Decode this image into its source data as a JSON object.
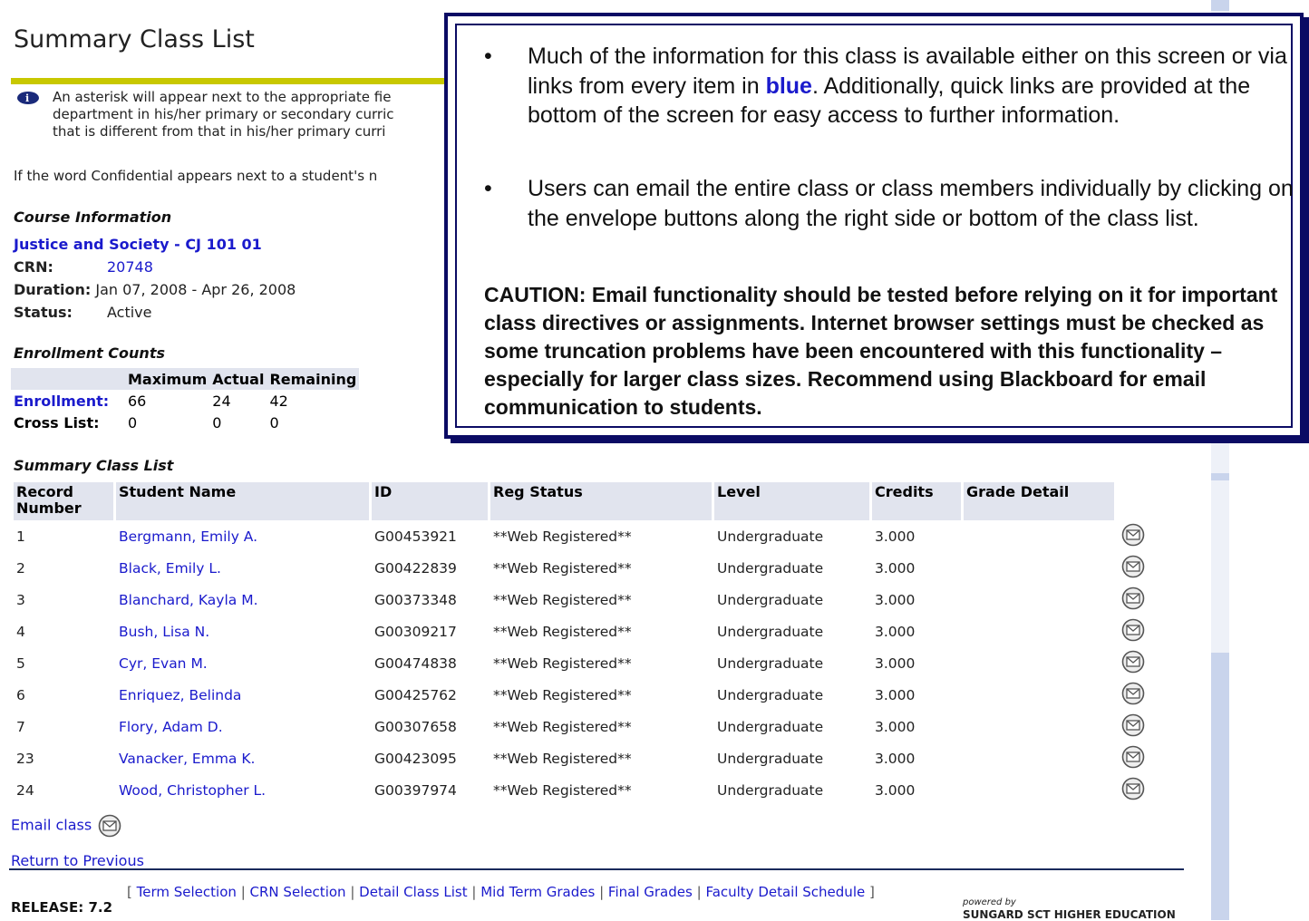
{
  "page_title": "Summary Class List",
  "info_note": {
    "line1": "An asterisk will appear next to the appropriate fie",
    "line2": "department in his/her primary or secondary curric",
    "line3": "that is different from that in his/her primary curri"
  },
  "confidential_note": "If the word Confidential appears next to a student's n",
  "course_info": {
    "heading": "Course Information",
    "title": "Justice and Society - CJ 101 01",
    "crn_label": "CRN:",
    "crn": "20748",
    "duration_label": "Duration:",
    "duration": "Jan 07, 2008 - Apr 26, 2008",
    "status_label": "Status:",
    "status": "Active"
  },
  "enrollment": {
    "heading": "Enrollment Counts",
    "headers": [
      "",
      "Maximum",
      "Actual",
      "Remaining"
    ],
    "rows": [
      {
        "label": "Enrollment:",
        "maximum": "66",
        "actual": "24",
        "remaining": "42"
      },
      {
        "label": "Cross List:",
        "maximum": "0",
        "actual": "0",
        "remaining": "0"
      }
    ]
  },
  "roster": {
    "heading": "Summary Class List",
    "headers": {
      "record": "Record Number",
      "name": "Student Name",
      "id": "ID",
      "reg_status": "Reg Status",
      "level": "Level",
      "credits": "Credits",
      "grade_detail": "Grade Detail"
    },
    "rows": [
      {
        "num": "1",
        "name": "Bergmann, Emily A.",
        "id": "G00453921",
        "reg": "**Web Registered**",
        "level": "Undergraduate",
        "credits": "3.000"
      },
      {
        "num": "2",
        "name": "Black, Emily L.",
        "id": "G00422839",
        "reg": "**Web Registered**",
        "level": "Undergraduate",
        "credits": "3.000"
      },
      {
        "num": "3",
        "name": "Blanchard, Kayla M.",
        "id": "G00373348",
        "reg": "**Web Registered**",
        "level": "Undergraduate",
        "credits": "3.000"
      },
      {
        "num": "4",
        "name": "Bush, Lisa N.",
        "id": "G00309217",
        "reg": "**Web Registered**",
        "level": "Undergraduate",
        "credits": "3.000"
      },
      {
        "num": "5",
        "name": "Cyr, Evan M.",
        "id": "G00474838",
        "reg": "**Web Registered**",
        "level": "Undergraduate",
        "credits": "3.000"
      },
      {
        "num": "6",
        "name": "Enriquez, Belinda",
        "id": "G00425762",
        "reg": "**Web Registered**",
        "level": "Undergraduate",
        "credits": "3.000"
      },
      {
        "num": "7",
        "name": "Flory, Adam D.",
        "id": "G00307658",
        "reg": "**Web Registered**",
        "level": "Undergraduate",
        "credits": "3.000"
      },
      {
        "num": "23",
        "name": "Vanacker, Emma K.",
        "id": "G00423095",
        "reg": "**Web Registered**",
        "level": "Undergraduate",
        "credits": "3.000"
      },
      {
        "num": "24",
        "name": "Wood, Christopher L.",
        "id": "G00397974",
        "reg": "**Web Registered**",
        "level": "Undergraduate",
        "credits": "3.000"
      }
    ],
    "row_icon": "envelope-icon"
  },
  "email_class": "Email class",
  "return_link": "Return to Previous",
  "footer": {
    "open_bracket": "[",
    "close_bracket": "]",
    "separator": "|",
    "links": [
      "Term Selection",
      "CRN Selection",
      "Detail Class List",
      "Mid Term Grades",
      "Final Grades",
      "Faculty Detail Schedule"
    ],
    "release": "RELEASE: 7.2",
    "powered_by": "powered by",
    "vendor": "SUNGARD SCT HIGHER EDUCATION"
  },
  "callout": {
    "bullet1_a": "Much of the information for this class is available either on this screen or via links from every item in ",
    "bullet1_blue": "blue",
    "bullet1_b": ".  Additionally, quick links are provided at the bottom of the screen for easy access to further information.",
    "bullet2": "Users can email the entire class or class members individually by clicking on the envelope buttons along the right side or bottom of the class list.",
    "caution": "CAUTION:  Email functionality should be tested before relying on it for important class directives or assignments. Internet browser settings must be checked as some truncation problems have been encountered with this functionality – especially for larger class sizes. Recommend using Blackboard for email communication to students."
  },
  "colors": {
    "link": "#1a1acc",
    "header_bg": "#e1e4ee",
    "title_rule": "#c8c800",
    "callout_border": "#0b0b64"
  }
}
